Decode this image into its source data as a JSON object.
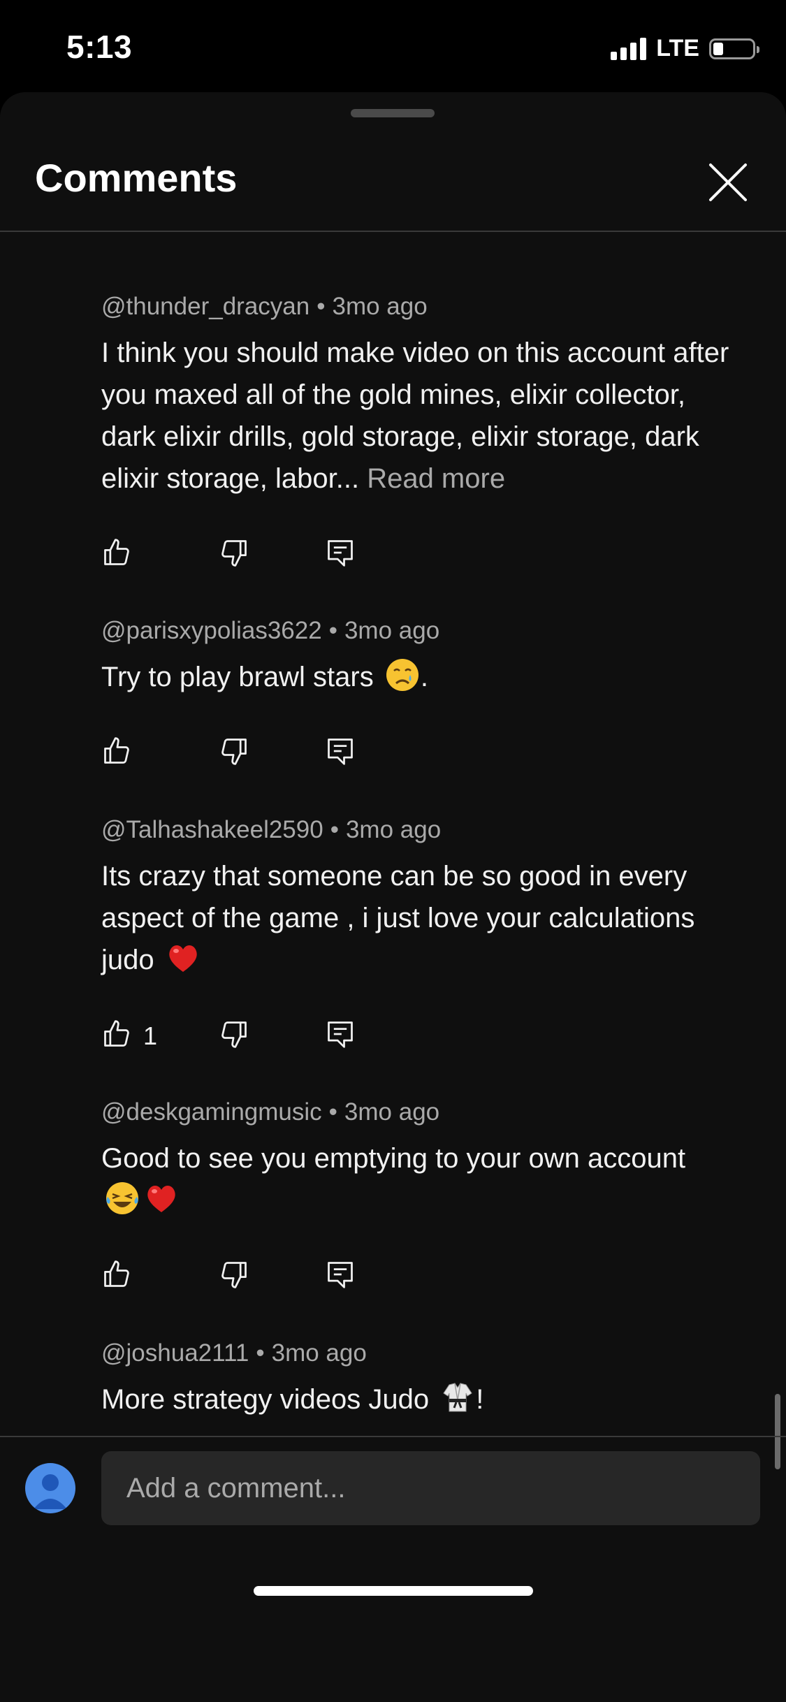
{
  "status_bar": {
    "time": "5:13",
    "network": "LTE",
    "battery_level": 0.25
  },
  "panel": {
    "title": "Comments"
  },
  "comments": [
    {
      "author": "@thunder_dracyan",
      "age": "3mo ago",
      "text": "I think you should make video on this account after you maxed all of the gold mines, elixir collector, dark elixir drills, gold storage, elixir storage, dark elixir storage, labor...",
      "read_more": "Read more",
      "likes": ""
    },
    {
      "author": "@parisxypolias3622",
      "age": "3mo ago",
      "text": "Try to play brawl stars",
      "text_suffix": ".",
      "emoji": "crying-face-emoji",
      "likes": ""
    },
    {
      "author": "@Talhashakeel2590",
      "age": "3mo ago",
      "text": "Its crazy that someone can be so good in every aspect of the game , i just love your calculations judo",
      "emoji": "red-heart-emoji",
      "likes": "1"
    },
    {
      "author": "@deskgamingmusic",
      "age": "3mo ago",
      "text": "Good to see you emptying to your own account",
      "emoji": "laughing-tears-emoji",
      "emoji2": "red-heart-emoji",
      "likes": ""
    },
    {
      "author": "@joshua2111",
      "age": "3mo ago",
      "text": "More strategy videos Judo",
      "text_suffix": "!",
      "emoji": "martial-arts-uniform-emoji",
      "likes": ""
    }
  ],
  "composer": {
    "placeholder": "Add a comment..."
  },
  "icons": {
    "like": "thumbs-up-icon",
    "dislike": "thumbs-down-icon",
    "reply": "reply-icon",
    "close": "close-icon"
  },
  "colors": {
    "background": "#0f0f0f",
    "text": "#f1f1f1",
    "secondary_text": "#aaaaaa",
    "avatar": "#4c8de8"
  }
}
